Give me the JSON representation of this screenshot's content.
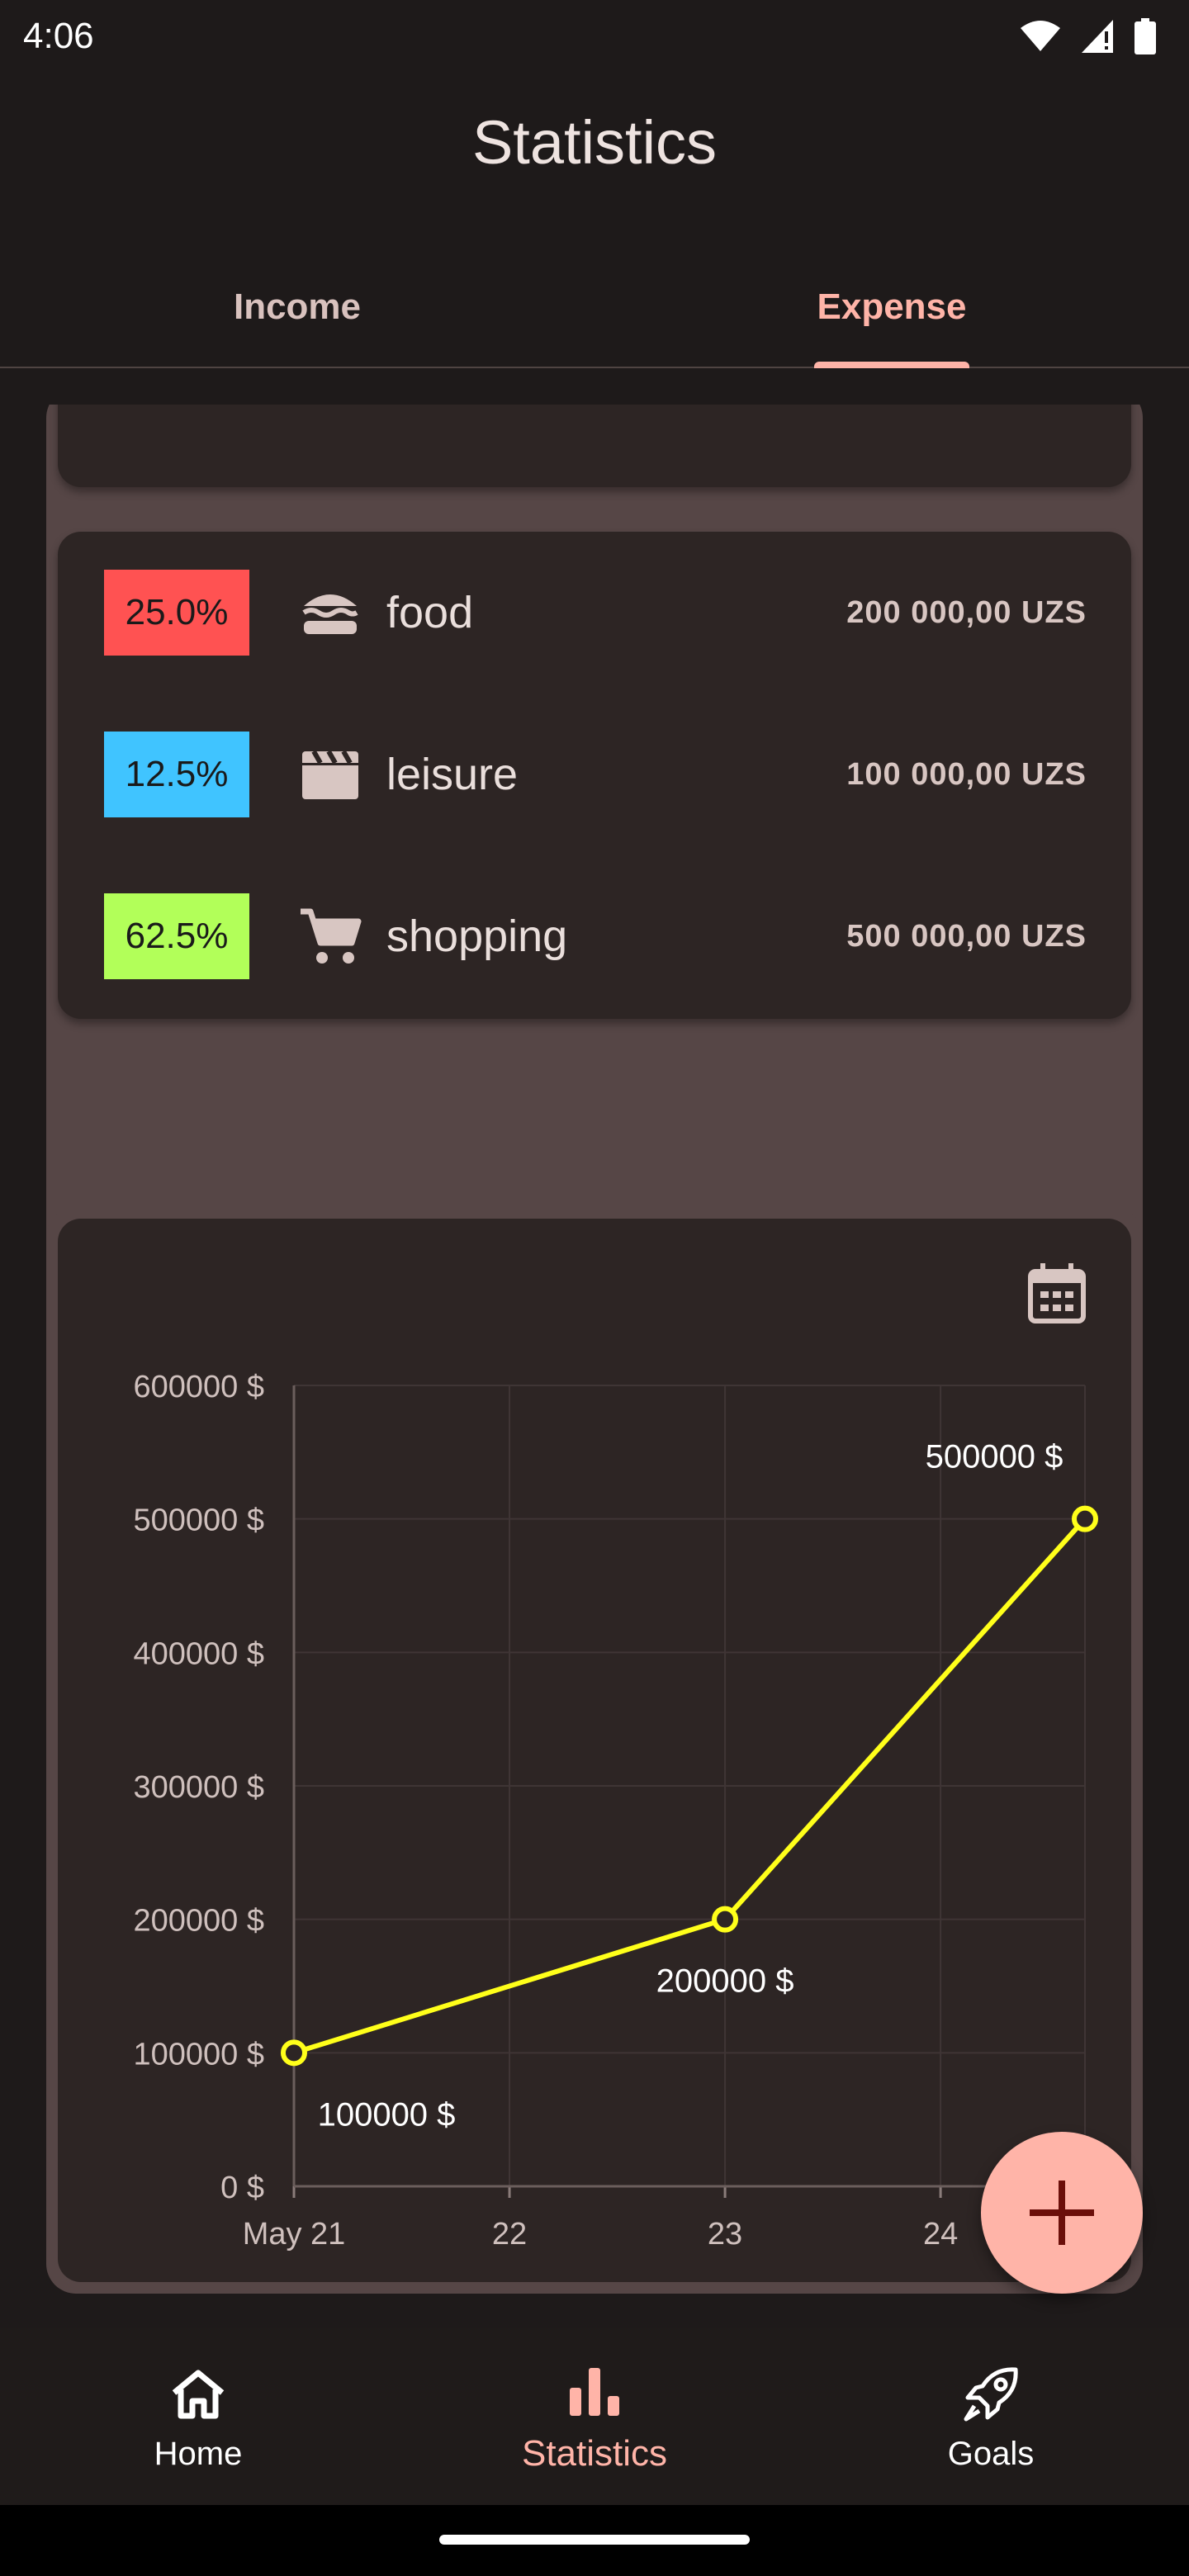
{
  "status_bar": {
    "time": "4:06"
  },
  "header": {
    "title": "Statistics"
  },
  "tabs": [
    {
      "label": "Income",
      "active": false
    },
    {
      "label": "Expense",
      "active": true
    }
  ],
  "categories": [
    {
      "percent": "25.0%",
      "name": "food",
      "amount": "200 000,00 UZS",
      "color": "#ff5252",
      "icon": "burger-icon"
    },
    {
      "percent": "12.5%",
      "name": "leisure",
      "amount": "100 000,00 UZS",
      "color": "#40c4ff",
      "icon": "clapperboard-icon"
    },
    {
      "percent": "62.5%",
      "name": "shopping",
      "amount": "500 000,00 UZS",
      "color": "#b2ff59",
      "icon": "cart-icon"
    }
  ],
  "chart_data": {
    "type": "line",
    "x": [
      "May 21",
      "23",
      "24+"
    ],
    "x_tick_labels": [
      "May 21",
      "22",
      "23",
      "24"
    ],
    "points": [
      {
        "x": 21,
        "y": 100000,
        "label": "100000 $"
      },
      {
        "x": 23,
        "y": 200000,
        "label": "200000 $"
      },
      {
        "x": 24.67,
        "y": 500000,
        "label": "500000 $"
      }
    ],
    "y_tick_labels": [
      "0 $",
      "100000 $",
      "200000 $",
      "300000 $",
      "400000 $",
      "500000 $",
      "600000 $"
    ],
    "ylim": [
      0,
      600000
    ],
    "xlim": [
      21,
      24.67
    ],
    "line_color": "#ffff1a",
    "grid": true
  },
  "bottom_nav": [
    {
      "label": "Home",
      "icon": "home-icon",
      "active": false
    },
    {
      "label": "Statistics",
      "icon": "bar-chart-icon",
      "active": true
    },
    {
      "label": "Goals",
      "icon": "rocket-icon",
      "active": false
    }
  ],
  "colors": {
    "accent": "#ffb4a8",
    "background": "#1e1a1a",
    "card": "#2d2524"
  }
}
